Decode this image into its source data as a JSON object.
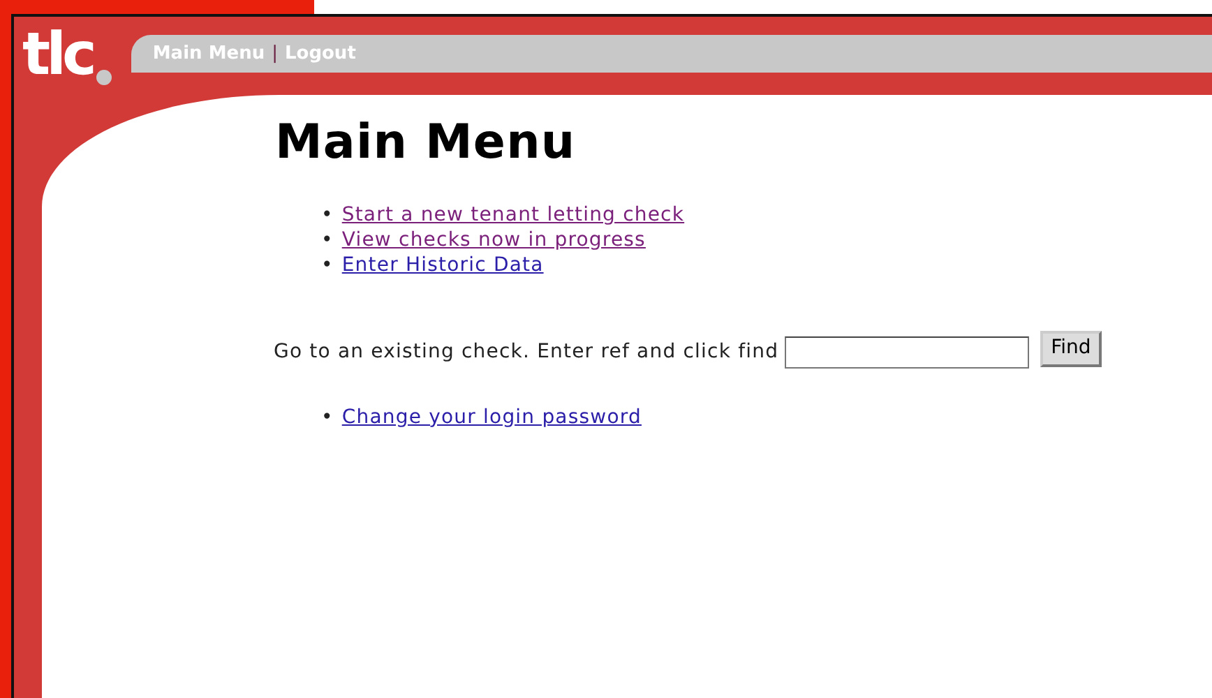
{
  "logo": {
    "text": "tlc"
  },
  "nav": [
    {
      "label": "Main Menu"
    },
    {
      "label": "Logout"
    }
  ],
  "nav_separator": "|",
  "title": "Main Menu",
  "bullet": "•",
  "menu_links": [
    {
      "label": "Start a new tenant letting check",
      "visited": true
    },
    {
      "label": "View checks now in progress",
      "visited": true
    },
    {
      "label": "Enter Historic Data",
      "visited": false
    }
  ],
  "find": {
    "label": "Go to an existing check. Enter ref and click find",
    "button": "Find"
  },
  "other_links": [
    {
      "label": "Change your login password",
      "visited": false
    }
  ]
}
